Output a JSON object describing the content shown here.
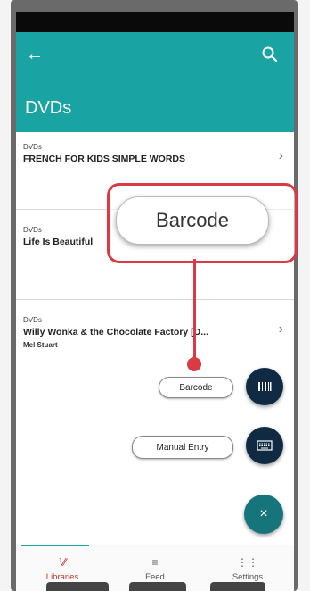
{
  "appbar": {
    "title": "DVDs",
    "back_icon": "arrow-left-icon",
    "search_icon": "search-icon",
    "color": "#1aa3a3"
  },
  "list": {
    "items": [
      {
        "category": "DVDs",
        "title": "FRENCH FOR KIDS SIMPLE WORDS",
        "subtitle": ""
      },
      {
        "category": "DVDs",
        "title": "Life Is Beautiful",
        "subtitle": ""
      },
      {
        "category": "DVDs",
        "title": "Willy Wonka & the Chocolate Factory [D...",
        "subtitle": "Mel Stuart"
      }
    ]
  },
  "fab_menu": {
    "barcode_label": "Barcode",
    "manual_entry_label": "Manual Entry",
    "close_label": "×",
    "barcode_icon": "barcode-icon",
    "manual_icon": "keyboard-icon",
    "close_icon": "close-icon"
  },
  "callout": {
    "label": "Barcode",
    "color": "#d93a44"
  },
  "bottom_nav": {
    "items": [
      {
        "label": "Libraries",
        "icon": "library-icon",
        "active": true
      },
      {
        "label": "Feed",
        "icon": "feed-icon",
        "active": false
      },
      {
        "label": "Settings",
        "icon": "settings-icon",
        "active": false
      }
    ],
    "active_color": "#c0392b"
  }
}
